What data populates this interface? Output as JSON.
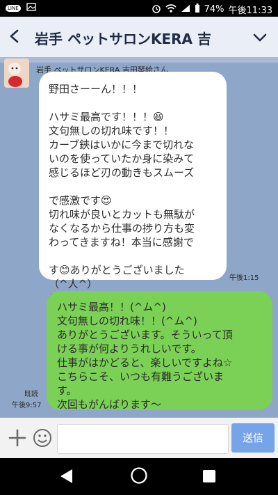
{
  "status_bar": {
    "app_badge": "LINE",
    "battery": "74%",
    "time": "午後11:33"
  },
  "header": {
    "title": "岩手 ペットサロンKERA 吉"
  },
  "chat": {
    "incoming_sender": "岩手 ペットサロンKERA 吉田琴絵さん",
    "incoming_message": "野田さーーん！！！\n\nハサミ最高です！！！😆\n文句無しの切れ味です！！\nカーブ鋏はいかに今まで切れな\nいのを使っていたか身に染みて\n感じるほど刃の動きもスムーズ\n\nで感激です😍\n切れ味が良いとカットも無駄が\nなくなるから仕事の捗り方も変\nわってきますね！本当に感謝で\n\nす😊ありがとうございました\n（^人^）\nまたお願いします🎵🙇",
    "incoming_time": "午後1:15",
    "outgoing_message": "ハサミ最高！！(^ム^)\n文句無しの切れ味！！(^ム^)\nありがとうございます。そういって頂\nける事が何よりうれしいです。\n仕事がはかどると、楽しいですよね☆\nこちらこそ、いつも有難うございま\nす。\n次回もがんばります〜",
    "outgoing_read": "既読",
    "outgoing_time": "午後9:57"
  },
  "input_bar": {
    "placeholder": "",
    "send_label": "送信"
  },
  "colors": {
    "chat_bg": "#8ea6c8",
    "outgoing_bubble": "#7bd155",
    "send_button": "#75a4e8"
  },
  "icons": {
    "back": "arrow-back-icon",
    "chevron": "chevron-down-icon",
    "plus": "plus-icon",
    "smiley": "smiley-icon"
  }
}
